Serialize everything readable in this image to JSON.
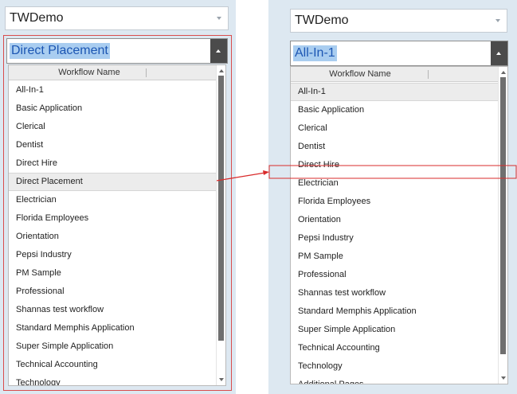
{
  "left_panel": {
    "company": "TWDemo",
    "selected_workflow": "Direct Placement",
    "list": {
      "header": "Workflow Name",
      "items": [
        "All-In-1",
        "Basic Application",
        "Clerical",
        "Dentist",
        "Direct Hire",
        "Direct Placement",
        "Electrician",
        "Florida Employees",
        "Orientation",
        "Pepsi Industry",
        "PM Sample",
        "Professional",
        "Shannas test workflow",
        "Standard Memphis Application",
        "Super Simple Application",
        "Technical Accounting",
        "Technology"
      ],
      "selected_index": 5
    }
  },
  "right_panel": {
    "company": "TWDemo",
    "selected_workflow": "All-In-1",
    "list": {
      "header": "Workflow Name",
      "items": [
        "All-In-1",
        "Basic Application",
        "Clerical",
        "Dentist",
        "Direct Hire",
        "Electrician",
        "Florida Employees",
        "Orientation",
        "Pepsi Industry",
        "PM Sample",
        "Professional",
        "Shannas test workflow",
        "Standard Memphis Application",
        "Super Simple Application",
        "Technical Accounting",
        "Technology",
        "Additional Pages"
      ],
      "selected_index": 0
    }
  },
  "colors": {
    "annotation": "#d92b2b",
    "selection_highlight": "#a9cdf0",
    "selection_text": "#1c56b3"
  },
  "icons": [
    "chevron-down-icon",
    "caret-up-icon",
    "scroll-up-icon",
    "scroll-down-icon"
  ]
}
